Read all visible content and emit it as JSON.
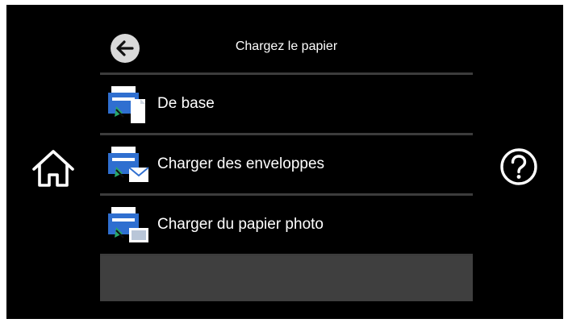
{
  "header": {
    "title": "Chargez le papier",
    "back_icon": "arrow-left-icon"
  },
  "menu": {
    "items": [
      {
        "label": "De base",
        "icon": "printer-plain-paper-icon"
      },
      {
        "label": "Charger des enveloppes",
        "icon": "printer-envelope-icon"
      },
      {
        "label": "Charger du papier photo",
        "icon": "printer-photo-paper-icon"
      }
    ]
  },
  "navigation": {
    "home_icon": "home-icon",
    "help_icon": "help-icon"
  },
  "colors": {
    "background": "#000000",
    "text": "#ffffff",
    "divider": "#3c3c3c",
    "empty_slot": "#3f3f3f",
    "icon_blue": "#2f6fd0",
    "icon_green": "#27a86b"
  }
}
